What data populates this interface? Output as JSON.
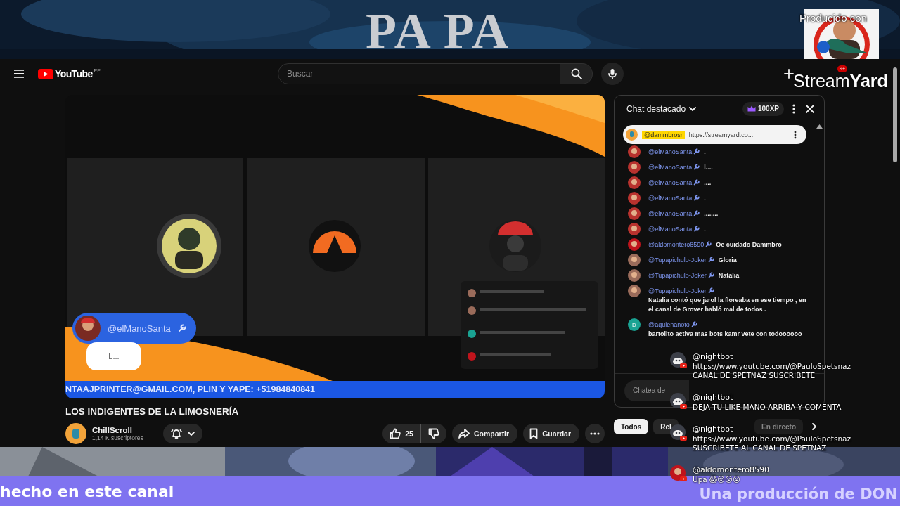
{
  "stream_overlay": {
    "banner_title": "PA PA",
    "produced_with": "Producido con",
    "brand": "Stream**Yard**"
  },
  "youtube": {
    "logo": "YouTube",
    "country": "PE",
    "search": {
      "placeholder": "Buscar"
    },
    "notifications_badge": "9+"
  },
  "video": {
    "name_tag": "@elManoSanta",
    "caption": "L...",
    "ticker": "NTAAJPRINTER@GMAIL.COM, PLIN Y YAPE: +51984840841"
  },
  "title": "LOS INDIGENTES DE LA LIMOSNERÍA",
  "channel": {
    "name": "ChillScroll",
    "subscribers": "1,14 K suscriptores"
  },
  "actions": {
    "likes": "25",
    "share": "Compartir",
    "save": "Guardar"
  },
  "chat": {
    "title": "Chat destacado",
    "xp": "100XP",
    "pinned": {
      "author": "@dammbrosr",
      "link": "https://streamyard.co..."
    },
    "messages": [
      {
        "color": "#b8322e",
        "author": "@elManoSanta",
        "moderator": true,
        "text": "."
      },
      {
        "color": "#b8322e",
        "author": "@elManoSanta",
        "moderator": true,
        "text": "l...."
      },
      {
        "color": "#b8322e",
        "author": "@elManoSanta",
        "moderator": true,
        "text": "...."
      },
      {
        "color": "#b8322e",
        "author": "@elManoSanta",
        "moderator": true,
        "text": "."
      },
      {
        "color": "#b8322e",
        "author": "@elManoSanta",
        "moderator": true,
        "text": "........"
      },
      {
        "color": "#b8322e",
        "author": "@elManoSanta",
        "moderator": true,
        "text": "."
      },
      {
        "color": "#c0141c",
        "author": "@aldomontero8590",
        "moderator": true,
        "text": "Oe cuidado Dammbro"
      },
      {
        "color": "#9a6b5a",
        "author": "@Tupapichulo-Joker",
        "moderator": true,
        "text": "Gloria"
      },
      {
        "color": "#9a6b5a",
        "author": "@Tupapichulo-Joker",
        "moderator": true,
        "text": "Natalia"
      },
      {
        "color": "#9a6b5a",
        "author": "@Tupapichulo-Joker",
        "moderator": true,
        "text": "Natalia contó que jarol la floreaba en ese tiempo , en el canal de Grover habló mal de todos ."
      },
      {
        "kind": "letter",
        "letter": "D",
        "color": "#1aa393",
        "author": "@aquienanoto",
        "moderator": true,
        "text": "bartolito activa mas bots kamr vete con todoooooo"
      }
    ],
    "input": {
      "placeholder": "Chatea de"
    }
  },
  "chips": [
    {
      "label": "Todos",
      "selected": true
    },
    {
      "label": "Rel",
      "selected": false
    },
    {
      "label": "En directo",
      "selected": false
    }
  ],
  "overlay_chat": [
    {
      "kind": "bot",
      "author": "@nightbot",
      "lines": [
        "https://www.youtube.com/@PauloSpetsnaz",
        "CANAL DE SPETNAZ SUSCRIBETE"
      ]
    },
    {
      "kind": "bot",
      "author": "@nightbot",
      "lines": [
        "DEJA TU LIKE MANO ARRIBA Y COMENTA"
      ]
    },
    {
      "kind": "bot",
      "author": "@nightbot",
      "lines": [
        "https://www.youtube.com/@PauloSpetsnaz",
        "SUSCRIBETE AL CANAL DE SPETNAZ"
      ]
    },
    {
      "author": "@aldomontero8590",
      "lines": [
        "Upa 😱😮😮😮"
      ]
    }
  ],
  "ticker": {
    "left": "hecho en este canal",
    "right": "Una producción de DON"
  }
}
